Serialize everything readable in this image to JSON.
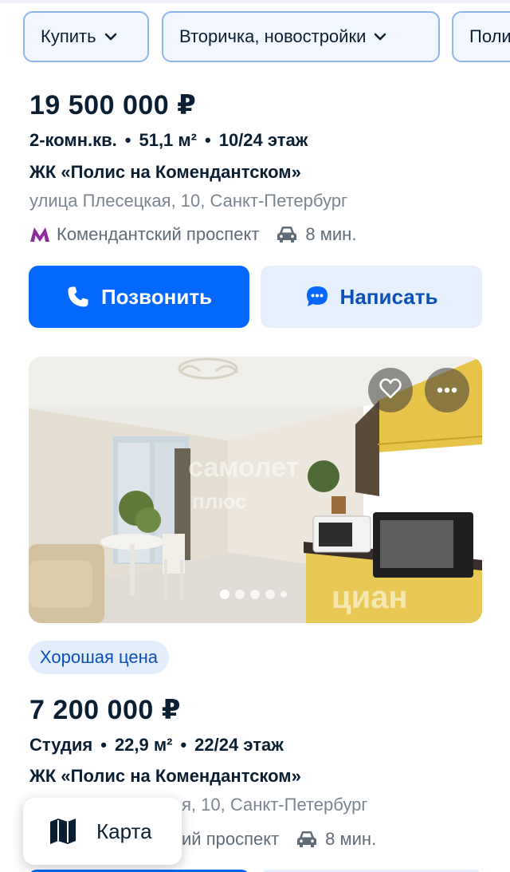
{
  "filters": [
    {
      "label": "Купить"
    },
    {
      "label": "Вторичка, новостройки"
    },
    {
      "label": "Поли"
    }
  ],
  "listing_1": {
    "price": "19 500 000 ₽",
    "rooms": "2-комн.кв.",
    "area": "51,1 м²",
    "floor": "10/24 этаж",
    "complex": "ЖК «Полис на Комендантском»",
    "address": "улица Плесецкая, 10, Санкт-Петербург",
    "metro": "Комендантский проспект",
    "travel_time": "8 мин.",
    "call_label": "Позвонить",
    "write_label": "Написать"
  },
  "listing_2": {
    "photo_dots": 5,
    "photo_active_index": 0,
    "watermark_1": "самолет",
    "watermark_2": "плюс",
    "watermark_3": "циан",
    "badge": "Хорошая цена",
    "price": "7 200 000 ₽",
    "rooms": "Студия",
    "area": "22,9 м²",
    "floor": "22/24 этаж",
    "complex": "ЖК «Полис на Комендантском»",
    "address_visible": "я, 10, Санкт-Петербург",
    "metro_visible": "ий проспект",
    "travel_time": "8 мин."
  },
  "map_button": {
    "label": "Карта"
  },
  "icons": {
    "chevron": "chevron-down-icon",
    "metro": "metro-icon",
    "car": "car-icon",
    "phone": "phone-icon",
    "chat": "chat-icon",
    "heart": "heart-icon",
    "more": "more-dots-icon",
    "map": "map-icon"
  },
  "colors": {
    "primary_blue": "#0468ff",
    "light_blue": "#e6effc",
    "metro_purple": "#8e2a9c",
    "text_dark": "#0b1f33",
    "text_gray": "#7a8591"
  }
}
